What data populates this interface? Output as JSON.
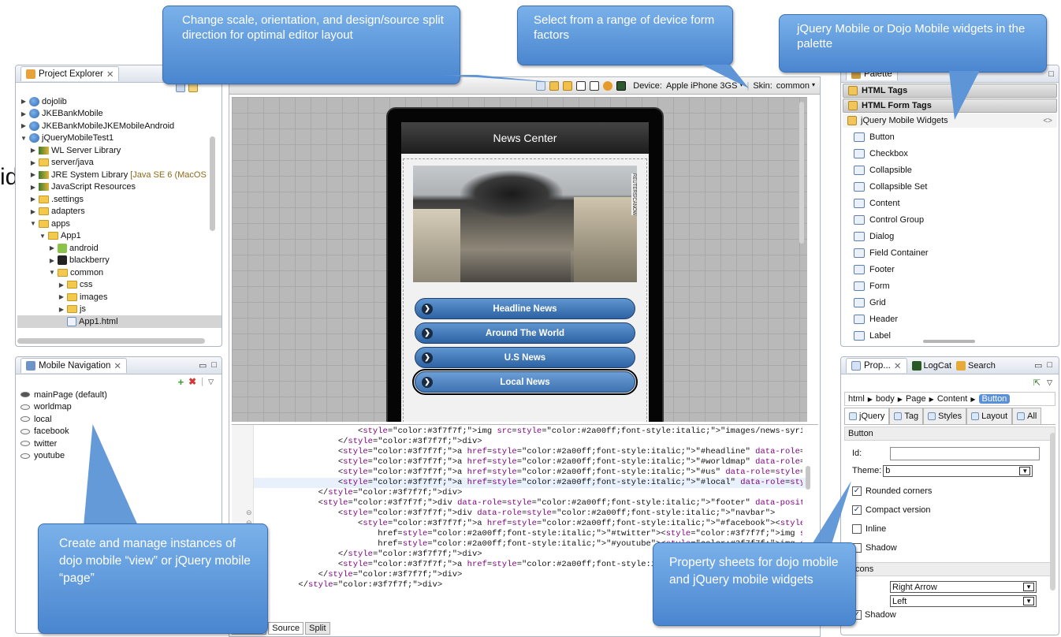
{
  "callouts": {
    "layout": "Change scale, orientation, and design/source split direction for optimal editor layout",
    "device": "Select from a range of device form factors",
    "palette": "jQuery Mobile or Dojo Mobile widgets in the palette",
    "navigation": "Create and manage instances of dojo mobile “view” or jQuery mobile “page”",
    "properties": "Property sheets for dojo mobile and jQuery mobile widgets"
  },
  "stray_text": "id",
  "project_explorer": {
    "title": "Project Explorer",
    "items": [
      {
        "label": "dojolib",
        "indent": 0,
        "twisty": "▶",
        "icon": "proj"
      },
      {
        "label": "JKEBankMobile",
        "indent": 0,
        "twisty": "▶",
        "icon": "proj"
      },
      {
        "label": "JKEBankMobileJKEMobileAndroid",
        "indent": 0,
        "twisty": "▶",
        "icon": "proj"
      },
      {
        "label": "jQueryMobileTest1",
        "indent": 0,
        "twisty": "▼",
        "icon": "proj"
      },
      {
        "label": "WL Server Library",
        "indent": 1,
        "twisty": "▶",
        "icon": "lib"
      },
      {
        "label": "server/java",
        "indent": 1,
        "twisty": "▶",
        "icon": "folder"
      },
      {
        "label": "JRE System Library",
        "suffix": "[Java SE 6 (MacOS",
        "indent": 1,
        "twisty": "▶",
        "icon": "lib"
      },
      {
        "label": "JavaScript Resources",
        "indent": 1,
        "twisty": "▶",
        "icon": "lib"
      },
      {
        "label": ".settings",
        "indent": 1,
        "twisty": "▶",
        "icon": "folder"
      },
      {
        "label": "adapters",
        "indent": 1,
        "twisty": "▶",
        "icon": "folder"
      },
      {
        "label": "apps",
        "indent": 1,
        "twisty": "▼",
        "icon": "folder"
      },
      {
        "label": "App1",
        "indent": 2,
        "twisty": "▼",
        "icon": "folder"
      },
      {
        "label": "android",
        "indent": 3,
        "twisty": "▶",
        "icon": "android"
      },
      {
        "label": "blackberry",
        "indent": 3,
        "twisty": "▶",
        "icon": "bb"
      },
      {
        "label": "common",
        "indent": 3,
        "twisty": "▼",
        "icon": "folder"
      },
      {
        "label": "css",
        "indent": 4,
        "twisty": "▶",
        "icon": "folder"
      },
      {
        "label": "images",
        "indent": 4,
        "twisty": "▶",
        "icon": "folder"
      },
      {
        "label": "js",
        "indent": 4,
        "twisty": "▶",
        "icon": "folder"
      },
      {
        "label": "App1.html",
        "indent": 4,
        "twisty": "",
        "icon": "html",
        "selected": true
      }
    ]
  },
  "mobile_navigation": {
    "title": "Mobile Navigation",
    "items": [
      "mainPage (default)",
      "worldmap",
      "local",
      "facebook",
      "twitter",
      "youtube"
    ]
  },
  "toolbar": {
    "device_label": "Device:",
    "device_value": "Apple iPhone 3GS",
    "skin_label": "Skin:",
    "skin_value": "common"
  },
  "phone": {
    "header": "News Center",
    "image_caption": "REUTERS/CANOW",
    "buttons": [
      "Headline News",
      "Around The World",
      "U.S News",
      "Local News"
    ]
  },
  "code_lines": [
    {
      "indent": "                    ",
      "text": "<img src=\"images/news-syria.jpg\" class=\"listed\">"
    },
    {
      "indent": "                ",
      "text": "</div>"
    },
    {
      "indent": "                ",
      "text": "<a href=\"#headline\" data-role=\"button\" data-icon=\"arrow-r\" data-theme=\"b\" data-corners=\"tru"
    },
    {
      "indent": "                ",
      "text": "<a href=\"#worldmap\" data-role=\"button\" data-icon=\"arrow-r\" data-theme=\"b\" data-mini=\"true\">"
    },
    {
      "indent": "                ",
      "text": "<a href=\"#us\" data-role=\"button\" data-icon=\"arrow-r\" data-theme=\"b\" data-mini=\"true\">U.S Ne"
    },
    {
      "indent": "                ",
      "text": "<a href=\"#local\" data-role=\"button\" data-icon=\"arrow-r\" data-theme=\"b\" data-mini=\"true\">Loc"
    },
    {
      "indent": "            ",
      "text": "</div>"
    },
    {
      "indent": "            ",
      "text": "<div data-role=\"footer\" data-position=\"fixed\">"
    },
    {
      "indent": "                ",
      "text": "<div data-role=\"navbar\">"
    },
    {
      "indent": "                    ",
      "text": "<a href=\"#facebook\"><img src=\"images/fb.png\"></a> <a"
    },
    {
      "indent": "                        ",
      "text": "href=\"#twitter\"><img src=\"images/twitter.png\"></a> <a"
    },
    {
      "indent": "                        ",
      "text": "href=\"#youtube\"><img src=\"images/yt.png\"></a>"
    },
    {
      "indent": "                ",
      "text": "</div>"
    },
    {
      "indent": "                ",
      "text": "<a href=\"#\" data-role=\"button\" data-icon=\"gear\" class=\"ui-btn-"
    },
    {
      "indent": "            ",
      "text": "</div>"
    },
    {
      "indent": "        ",
      "text": "</div>"
    }
  ],
  "editor_tabs": [
    "Design",
    "Source",
    "Split"
  ],
  "palette": {
    "title": "Palette",
    "groups": [
      "HTML Tags",
      "HTML Form Tags",
      "jQuery Mobile Widgets"
    ],
    "items": [
      "Button",
      "Checkbox",
      "Collapsible",
      "Collapsible Set",
      "Content",
      "Control Group",
      "Dialog",
      "Field Container",
      "Footer",
      "Form",
      "Grid",
      "Header",
      "Label"
    ]
  },
  "properties": {
    "tabs": [
      "Prop...",
      "LogCat",
      "Search"
    ],
    "breadcrumb": [
      "html",
      "body",
      "Page",
      "Content",
      "Button"
    ],
    "subtabs": [
      "jQuery",
      "Tag",
      "Styles",
      "Layout",
      "All"
    ],
    "section": "Button",
    "id_label": "Id:",
    "id_value": "",
    "theme_label": "Theme:",
    "theme_value": "b",
    "checks": [
      {
        "label": "Rounded corners",
        "checked": true
      },
      {
        "label": "Compact version",
        "checked": true
      },
      {
        "label": "Inline",
        "checked": false
      },
      {
        "label": "Shadow",
        "checked": false
      }
    ],
    "icon_section": "Icons",
    "icon_value": "Right Arrow",
    "icon_pos_value": "Left",
    "shadow_label": "Shadow"
  }
}
